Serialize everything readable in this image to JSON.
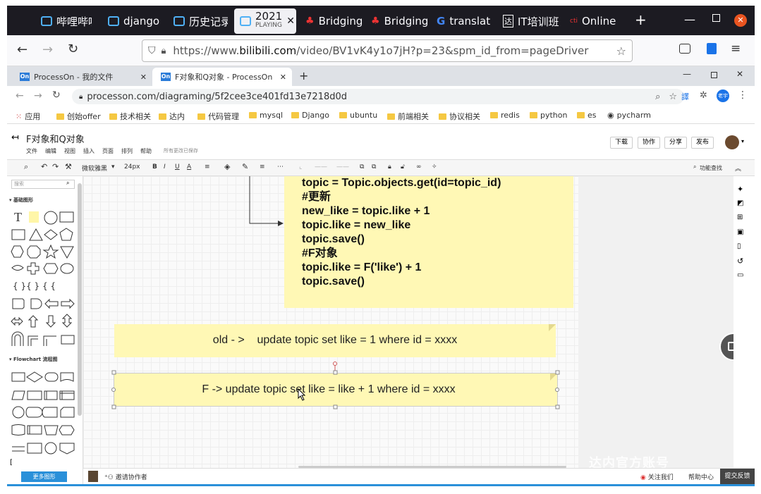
{
  "firefox": {
    "tabs": [
      {
        "label": "哔哩哔哩"
      },
      {
        "label": "django"
      },
      {
        "label": "历史记录"
      },
      {
        "label": "2021",
        "sub": "PLAYING"
      },
      {
        "label": "Bridging"
      },
      {
        "label": "Bridging"
      },
      {
        "label": "translat"
      },
      {
        "label": "IT培训班"
      },
      {
        "label": "Online"
      }
    ],
    "url": "https://www.bilibili.com/video/BV1vK4y1o7jH?p=23&spm_id_from=pageDriver",
    "url_host": "bilibili.com",
    "url_prefix": "https://www.",
    "url_suffix": "/video/BV1vK4y1o7jH?p=23&spm_id_from=pageDriver"
  },
  "chrome": {
    "tabs": [
      {
        "label": "ProcessOn - 我的文件"
      },
      {
        "label": "F对象和Q对象 - ProcessOn"
      }
    ],
    "url": "processon.com/diagraming/5f2cee3ce401fd13e7218d0d",
    "profile": "老宇",
    "bookmarks": [
      "应用",
      "创始offer",
      "技术相关",
      "达内",
      "代码管理",
      "mysql",
      "Django",
      "ubuntu",
      "前端相关",
      "协议相关",
      "redis",
      "python",
      "es",
      "pycharm"
    ]
  },
  "processon": {
    "title": "F对象和Q对象",
    "menu": [
      "文件",
      "编辑",
      "视图",
      "插入",
      "页面",
      "排列",
      "帮助"
    ],
    "save_status": "所有更改已保存",
    "buttons": {
      "download": "下载",
      "collab": "协作",
      "share": "分享",
      "publish": "发布"
    },
    "toolbar": {
      "font": "微软雅黑",
      "size": "24px",
      "find": "功能查找"
    },
    "sidebar": {
      "search_placeholder": "搜索",
      "basic_section": "基础图形",
      "flowchart_section": "Flowchart 流程图",
      "more_button": "更多图形"
    },
    "footer": {
      "invite": "邀请协作者",
      "follow": "关注我们",
      "help": "帮助中心",
      "feedback": "提交反馈"
    }
  },
  "canvas": {
    "code_lines": [
      "topic = Topic.objects.get(id=topic_id)",
      "#更新",
      "new_like = topic.like + 1",
      "topic.like = new_like",
      "topic.save()",
      "#F对象",
      "topic.like = F('like') + 1",
      "topic.save()"
    ],
    "note_old": "old - >    update topic set like = 1 where id = xxxx",
    "note_f": "F -> update topic set like = like + 1 where id = xxxx"
  },
  "watermark": "达内官方账号",
  "colors": {
    "note": "#fff8b5",
    "accent": "#2a7bd8"
  }
}
